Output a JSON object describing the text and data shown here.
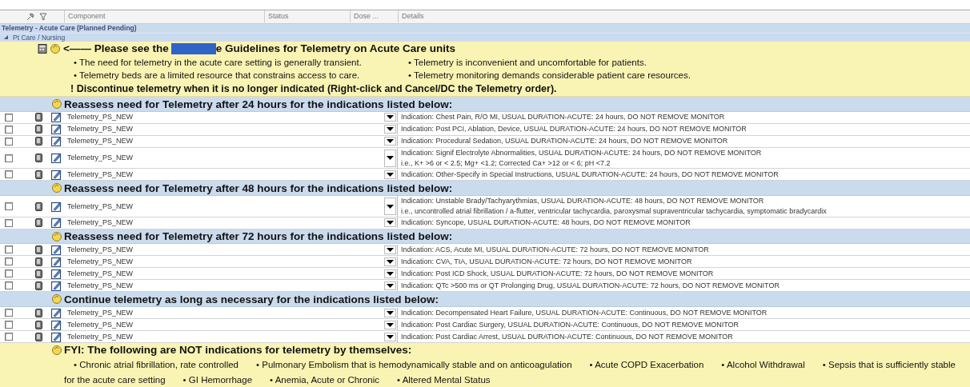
{
  "columns": [
    "Component",
    "Status",
    "Dose ...",
    "Details"
  ],
  "title": "Telemetry - Acute Care (Planned Pending)",
  "category": {
    "label": "Pt Care / Nursing",
    "expanded": true
  },
  "guidelines": {
    "heading_before": "<—— Please see the",
    "heading_after": "e Guidelines for Telemetry on Acute Care units",
    "bullets": [
      [
        "• The need for telemetry in the acute care setting is generally transient.",
        "• Telemetry is inconvenient and uncomfortable for patients."
      ],
      [
        "• Telemetry beds are a limited resource that constrains access to care.",
        "• Telemetry monitoring demands considerable patient care resources."
      ]
    ],
    "warning": "! Discontinue telemetry when it is no longer indicated (Right-click and Cancel/DC the Telemetry order)."
  },
  "sections": [
    {
      "title": "Reassess need for Telemetry after 24 hours for the indications listed below:",
      "rows": [
        {
          "component": "Telemetry_PS_NEW",
          "checked": false,
          "details": [
            "Indication: Chest Pain, R/O MI, USUAL DURATION-ACUTE: 24 hours, DO NOT REMOVE MONITOR"
          ]
        },
        {
          "component": "Telemetry_PS_NEW",
          "checked": false,
          "details": [
            "Indication: Post PCI, Ablation, Device, USUAL DURATION-ACUTE: 24 hours, DO NOT REMOVE MONITOR"
          ]
        },
        {
          "component": "Telemetry_PS_NEW",
          "checked": false,
          "details": [
            "Indication: Procedural Sedation, USUAL DURATION-ACUTE: 24 hours, DO NOT REMOVE MONITOR"
          ]
        },
        {
          "component": "Telemetry_PS_NEW",
          "checked": false,
          "details": [
            "Indication: Signif Electrolyte Abnormalities, USUAL DURATION-ACUTE: 24 hours, DO NOT REMOVE MONITOR",
            "i.e., K+ >6 or < 2.5;  Mg+ <1.2;  Corrected Ca+ >12 or < 6;  pH <7.2"
          ]
        },
        {
          "component": "Telemetry_PS_NEW",
          "checked": false,
          "details": [
            "Indication: Other-Specify in Special Instructions, USUAL DURATION-ACUTE: 24 hours, DO NOT REMOVE MONITOR"
          ]
        }
      ]
    },
    {
      "title": "Reassess need for Telemetry after 48 hours for the indications listed below:",
      "rows": [
        {
          "component": "Telemetry_PS_NEW",
          "checked": false,
          "details": [
            "Indication: Unstable Brady/Tachyarythmias, USUAL DURATION-ACUTE: 48 hours, DO NOT REMOVE MONITOR",
            "i.e., uncontrolled atrial fibrillation / a-flutter, ventricular tachycardia, paroxysmal supraventricular tachycardia, symptomatic bradycardix"
          ]
        },
        {
          "component": "Telemetry_PS_NEW",
          "checked": false,
          "details": [
            "Indication: Syncope, USUAL DURATION-ACUTE: 48 hours, DO NOT REMOVE MONITOR"
          ]
        }
      ]
    },
    {
      "title": "Reassess need for Telemetry after 72 hours for the indications listed below:",
      "rows": [
        {
          "component": "Telemetry_PS_NEW",
          "checked": false,
          "details": [
            "Indication: ACS, Acute MI, USUAL DURATION-ACUTE: 72 hours, DO NOT REMOVE MONITOR"
          ]
        },
        {
          "component": "Telemetry_PS_NEW",
          "checked": false,
          "details": [
            "Indication: CVA, TIA, USUAL DURATION-ACUTE: 72 hours, DO NOT REMOVE MONITOR"
          ]
        },
        {
          "component": "Telemetry_PS_NEW",
          "checked": false,
          "details": [
            "Indication: Post ICD Shock, USUAL DURATION-ACUTE: 72 hours, DO NOT REMOVE MONITOR"
          ]
        },
        {
          "component": "Telemetry_PS_NEW",
          "checked": false,
          "details": [
            "Indication: QTc >500 ms or QT Prolonging Drug, USUAL DURATION-ACUTE: 72 hours, DO NOT REMOVE MONITOR"
          ]
        }
      ]
    },
    {
      "title": "Continue telemetry as long as necessary for the indications listed below:",
      "rows": [
        {
          "component": "Telemetry_PS_NEW",
          "checked": false,
          "details": [
            "Indication: Decompensated Heart Failure, USUAL DURATION-ACUTE: Continuous, DO NOT REMOVE MONITOR"
          ]
        },
        {
          "component": "Telemetry_PS_NEW",
          "checked": false,
          "details": [
            "Indication: Post Cardiac Surgery, USUAL DURATION-ACUTE: Continuous, DO NOT REMOVE MONITOR"
          ]
        },
        {
          "component": "Telemetry_PS_NEW",
          "checked": false,
          "details": [
            "Indication: Post Cardiac Arrest, USUAL DURATION-ACUTE: Continuous, DO NOT REMOVE MONITOR"
          ]
        }
      ]
    }
  ],
  "fyi": {
    "title": "FYI: The following are NOT indications for telemetry by themselves:",
    "items": [
      "• Chronic atrial fibrillation, rate controlled",
      "• Pulmonary Embolism that is hemodynamically stable and on anticoagulation",
      "• Acute COPD Exacerbation",
      "• Alcohol Withdrawal",
      "• Sepsis that is sufficiently stable for the acute care setting",
      "• GI Hemorrhage",
      "• Anemia, Acute or Chronic",
      "• Altered Mental Status"
    ]
  }
}
